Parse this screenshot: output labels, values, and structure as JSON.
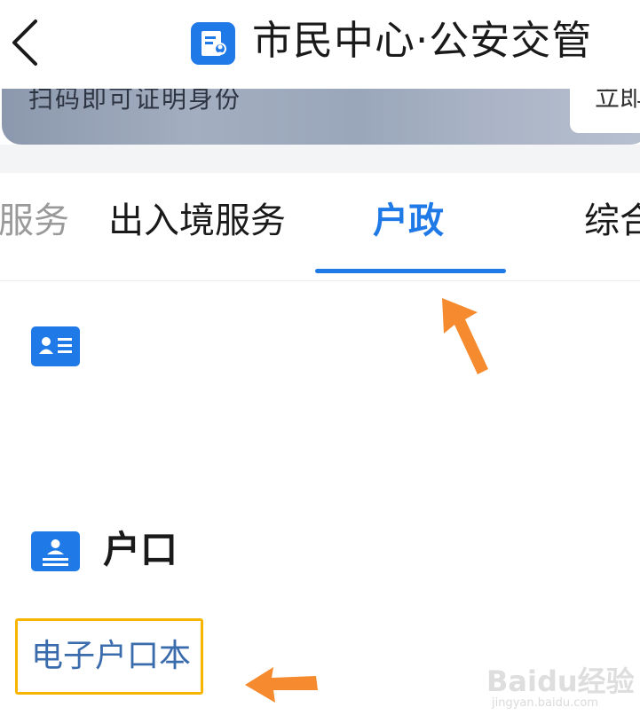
{
  "header": {
    "title": "市民中心·公安交管",
    "back_icon": "chevron-left-icon",
    "app_icon": "document-person-icon"
  },
  "banner": {
    "text": "扫码即可证明身份",
    "button_label": "立即"
  },
  "tabs": [
    {
      "label": "服务",
      "state": "partial"
    },
    {
      "label": "出入境服务",
      "state": "normal"
    },
    {
      "label": "户政",
      "state": "active"
    },
    {
      "label": "综合",
      "state": "partial"
    }
  ],
  "sections": [
    {
      "icon": "id-card-icon",
      "title": ""
    },
    {
      "icon": "household-register-icon",
      "title": "户口"
    }
  ],
  "item": {
    "label": "电子户口本"
  },
  "watermark": {
    "logo": "Baidu经验",
    "url": "jingyan.baidu.com"
  },
  "colors": {
    "accent": "#1f7ae8",
    "highlight_box": "#f7b500",
    "annotation_arrow": "#f58a2e",
    "item_text": "#3a6cad"
  }
}
